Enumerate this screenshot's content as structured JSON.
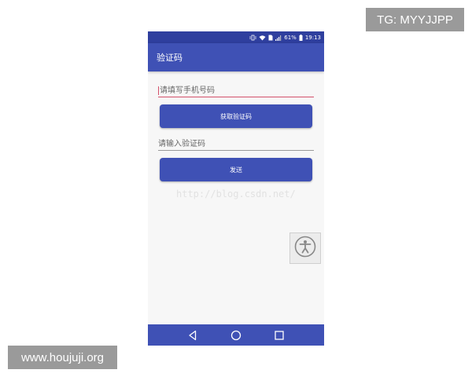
{
  "badges": {
    "tg": "TG: MYYJJPP",
    "site": "www.houjuji.org"
  },
  "status_bar": {
    "battery": "61%",
    "time": "19:13"
  },
  "app_bar": {
    "title": "验证码"
  },
  "form": {
    "phone_placeholder": "请填写手机号码",
    "get_code_label": "获取验证码",
    "code_placeholder": "请输入验证码",
    "send_label": "发送"
  },
  "watermark": "http://blog.csdn.net/",
  "colors": {
    "primary": "#3f51b5",
    "primary_dark": "#2f3f9e",
    "accent": "#d4506a"
  },
  "icons": {
    "status": [
      "vibrate-icon",
      "wifi-icon",
      "sim-icon",
      "signal-icon",
      "battery-icon"
    ],
    "nav": [
      "back-icon",
      "home-icon",
      "recents-icon"
    ],
    "floating": "accessibility-icon"
  }
}
